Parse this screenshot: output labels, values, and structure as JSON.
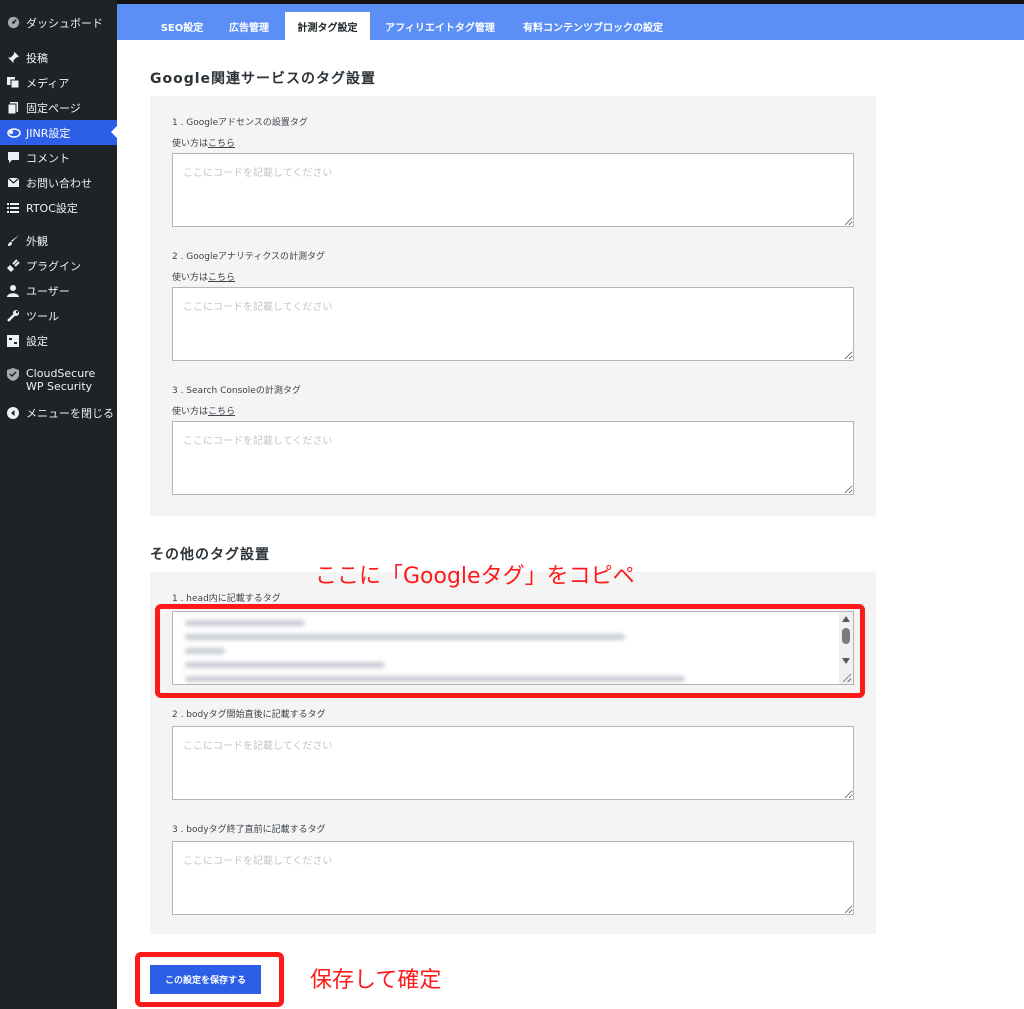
{
  "sidebar": {
    "items": [
      {
        "label": "ダッシュボード",
        "icon": "dashboard-icon"
      },
      {
        "label": "投稿",
        "icon": "pin-icon"
      },
      {
        "label": "メディア",
        "icon": "media-icon"
      },
      {
        "label": "固定ページ",
        "icon": "page-icon"
      },
      {
        "label": "JINR設定",
        "icon": "cloud-icon"
      },
      {
        "label": "コメント",
        "icon": "comment-icon"
      },
      {
        "label": "お問い合わせ",
        "icon": "mail-icon"
      },
      {
        "label": "RTOC設定",
        "icon": "list-icon"
      },
      {
        "label": "外観",
        "icon": "brush-icon"
      },
      {
        "label": "プラグイン",
        "icon": "plugin-icon"
      },
      {
        "label": "ユーザー",
        "icon": "user-icon"
      },
      {
        "label": "ツール",
        "icon": "wrench-icon"
      },
      {
        "label": "設定",
        "icon": "settings-icon"
      },
      {
        "label": "CloudSecure WP Security",
        "icon": "shield-icon"
      },
      {
        "label": "メニューを閉じる",
        "icon": "collapse-icon"
      }
    ],
    "active_item": "JINR設定",
    "accent": "#2c5fe6"
  },
  "tabs": [
    {
      "label": "SEO設定"
    },
    {
      "label": "広告管理"
    },
    {
      "label": "計測タグ設定"
    },
    {
      "label": "アフィリエイトタグ管理"
    },
    {
      "label": "有料コンテンツブロックの設定"
    }
  ],
  "active_tab": "計測タグ設定",
  "google_section": {
    "heading": "Google関連サービスのタグ設置",
    "fields": [
      {
        "label": "1 . Googleアドセンスの設置タグ",
        "howto_prefix": "使い方は",
        "howto_link": "こちら",
        "placeholder": "ここにコードを記載してください"
      },
      {
        "label": "2 . Googleアナリティクスの計測タグ",
        "howto_prefix": "使い方は",
        "howto_link": "こちら",
        "placeholder": "ここにコードを記載してください"
      },
      {
        "label": "3 . Search Consoleの計測タグ",
        "howto_prefix": "使い方は",
        "howto_link": "こちら",
        "placeholder": "ここにコードを記載してください"
      }
    ]
  },
  "other_section": {
    "heading": "その他のタグ設置",
    "fields": [
      {
        "label": "1 . head内に記載するタグ"
      },
      {
        "label": "2 . bodyタグ開始直後に記載するタグ",
        "placeholder": "ここにコードを記載してください"
      },
      {
        "label": "3 . bodyタグ終了直前に記載するタグ",
        "placeholder": "ここにコードを記載してください"
      }
    ]
  },
  "save_button_label": "この設定を保存する",
  "annotations": {
    "paste_note": "ここに「Googleタグ」をコピペ",
    "save_note": "保存して確定",
    "color": "#ff1a1a"
  }
}
